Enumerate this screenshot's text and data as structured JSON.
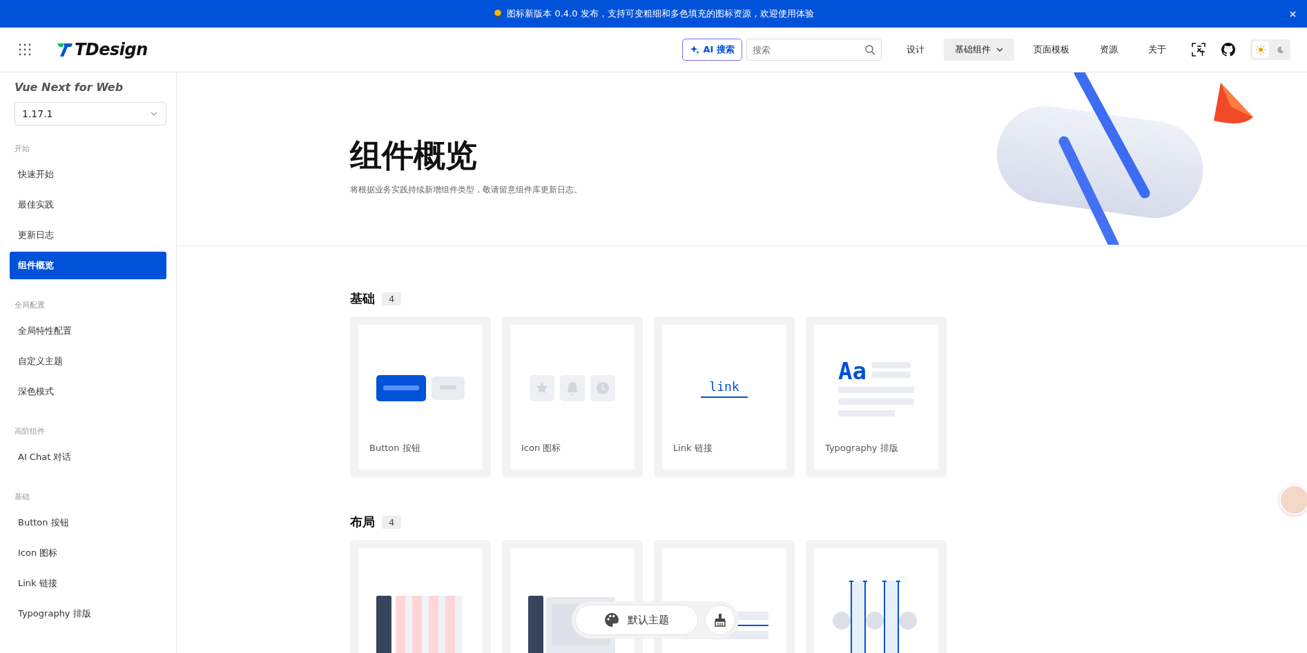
{
  "announcement": {
    "text": "图标新版本 0.4.0 发布，支持可变粗细和多色填充的图标资源，欢迎使用体验",
    "closable": true
  },
  "header": {
    "logo": "TDesign",
    "ai_button": "AI 搜索",
    "search": {
      "placeholder": "搜索"
    },
    "nav": [
      {
        "label": "设计",
        "selected": false,
        "dropdown": false
      },
      {
        "label": "基础组件",
        "selected": true,
        "dropdown": true
      },
      {
        "label": "页面模板",
        "selected": false,
        "dropdown": false
      },
      {
        "label": "资源",
        "selected": false,
        "dropdown": false
      },
      {
        "label": "关于",
        "selected": false,
        "dropdown": false
      }
    ],
    "theme": [
      {
        "kind": "light",
        "selected": true
      },
      {
        "kind": "dark",
        "selected": false
      }
    ]
  },
  "sidebar": {
    "title": "Vue Next for Web",
    "version": "1.17.1",
    "groups": [
      {
        "title": "开始",
        "items": [
          {
            "label": "快速开始",
            "selected": false
          },
          {
            "label": "最佳实践",
            "selected": false
          },
          {
            "label": "更新日志",
            "selected": false
          },
          {
            "label": "组件概览",
            "selected": true
          }
        ]
      },
      {
        "title": "全局配置",
        "items": [
          {
            "label": "全局特性配置",
            "selected": false
          },
          {
            "label": "自定义主题",
            "selected": false
          },
          {
            "label": "深色模式",
            "selected": false
          }
        ]
      },
      {
        "title": "高阶组件",
        "items": [
          {
            "label": "AI Chat 对话",
            "selected": false
          }
        ]
      },
      {
        "title": "基础",
        "items": [
          {
            "label": "Button 按钮",
            "selected": false
          },
          {
            "label": "Icon 图标",
            "selected": false
          },
          {
            "label": "Link 链接",
            "selected": false
          },
          {
            "label": "Typography 排版",
            "selected": false
          }
        ]
      }
    ]
  },
  "hero": {
    "title": "组件概览",
    "subtitle": "将根据业务实践持续新增组件类型，敬请留意组件库更新日志。"
  },
  "sections": [
    {
      "title": "基础",
      "count": "4",
      "cards": [
        {
          "kind": "button",
          "label": "Button 按钮"
        },
        {
          "kind": "icon",
          "label": "Icon 图标"
        },
        {
          "kind": "link",
          "label": "Link 链接",
          "preview_text": "link"
        },
        {
          "kind": "typography",
          "label": "Typography 排版",
          "preview_text": "Aa"
        }
      ]
    },
    {
      "title": "布局",
      "count": "4",
      "cards": [
        {
          "kind": "grid"
        },
        {
          "kind": "layout"
        },
        {
          "kind": "divider"
        },
        {
          "kind": "space"
        }
      ]
    }
  ],
  "theme_switcher": {
    "label": "默认主题"
  }
}
